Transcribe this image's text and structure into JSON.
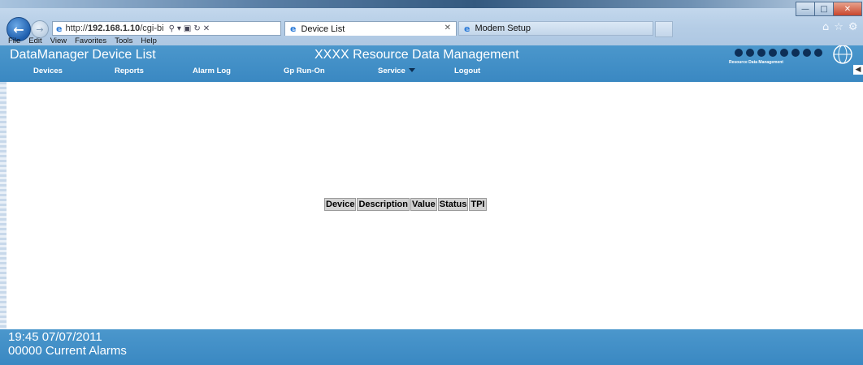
{
  "browser": {
    "address": "http://192.168.1.10/cgi-bi",
    "address_prefix": "http://",
    "address_host": "192.168.1.10",
    "address_path": "/cgi-bi",
    "tabs": [
      {
        "label": "Device List"
      },
      {
        "label": "Modem Setup"
      }
    ],
    "menu": [
      "File",
      "Edit",
      "View",
      "Favorites",
      "Tools",
      "Help"
    ]
  },
  "app": {
    "title": "DataManager Device List",
    "center_title": "XXXX Resource Data Management",
    "logo_text": "Resource Data Management",
    "nav": [
      "Devices",
      "Reports",
      "Alarm Log",
      "Gp Run-On",
      "Service",
      "Logout"
    ]
  },
  "table": {
    "headers": [
      "Device",
      "Description",
      "Value",
      "Status",
      "TPI"
    ]
  },
  "footer": {
    "datetime": "19:45 07/07/2011",
    "alarms": "00000 Current Alarms"
  },
  "colors": {
    "header_blue": "#4393c9",
    "table_header_gray": "#d2d2d2"
  }
}
